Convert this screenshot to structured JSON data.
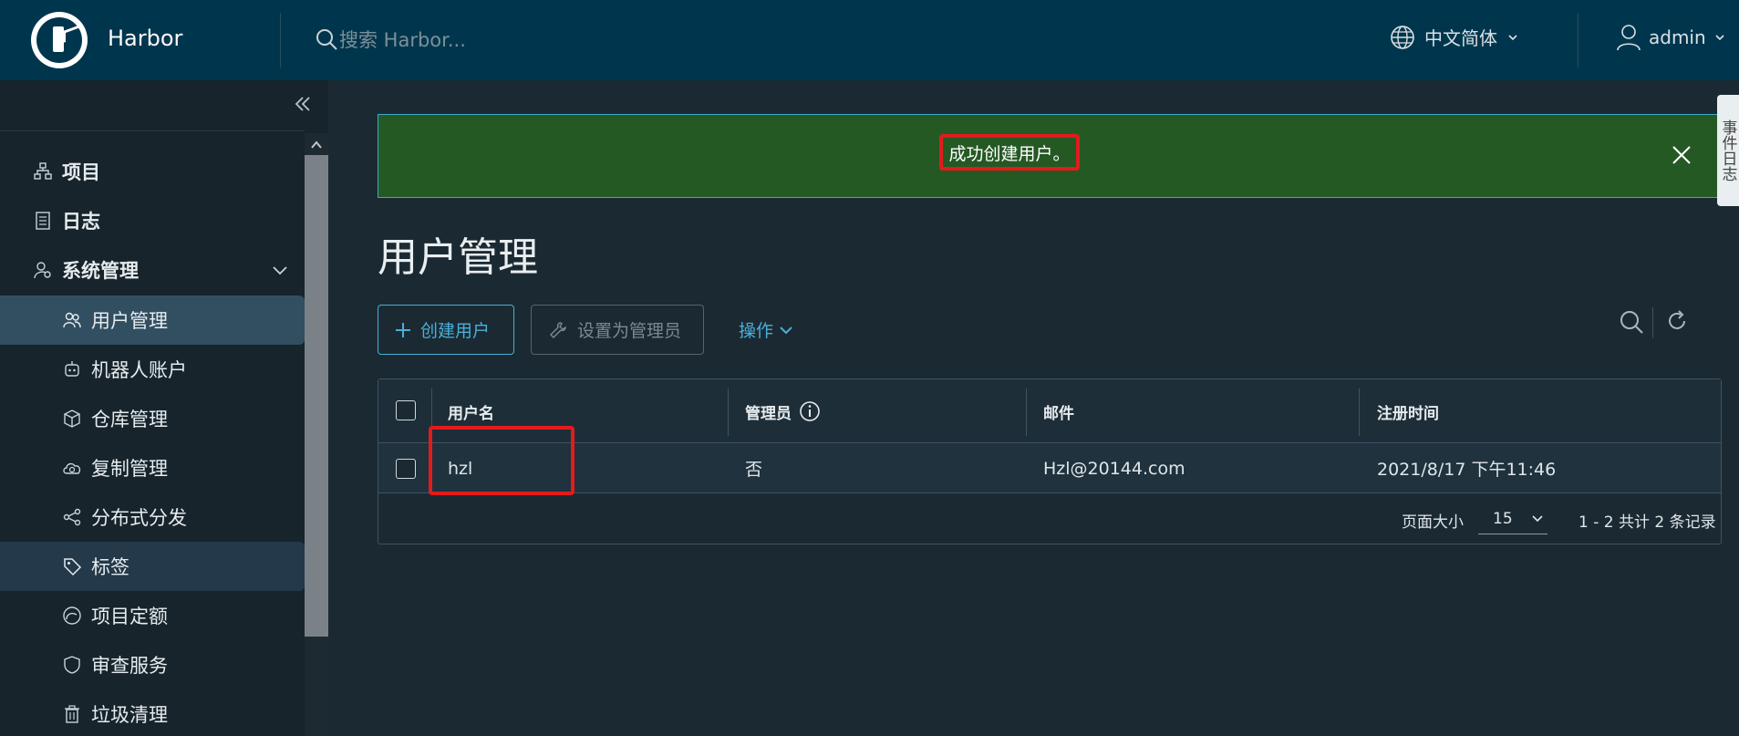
{
  "header": {
    "brand": "Harbor",
    "search_placeholder": "搜索 Harbor...",
    "language": "中文简体",
    "user": "admin"
  },
  "sidebar": {
    "items": [
      {
        "label": "项目",
        "icon": "projects-icon"
      },
      {
        "label": "日志",
        "icon": "logs-icon"
      },
      {
        "label": "系统管理",
        "icon": "admin-settings-icon"
      },
      {
        "label": "用户管理",
        "icon": "users-icon"
      },
      {
        "label": "机器人账户",
        "icon": "robot-icon"
      },
      {
        "label": "仓库管理",
        "icon": "registry-box-icon"
      },
      {
        "label": "复制管理",
        "icon": "cloud-replication-icon"
      },
      {
        "label": "分布式分发",
        "icon": "share-icon"
      },
      {
        "label": "标签",
        "icon": "tag-icon"
      },
      {
        "label": "项目定额",
        "icon": "quota-gauge-icon"
      },
      {
        "label": "审查服务",
        "icon": "shield-icon"
      },
      {
        "label": "垃圾清理",
        "icon": "trash-icon"
      }
    ]
  },
  "alert": {
    "message": "成功创建用户。",
    "side_tab": "事件日志"
  },
  "page": {
    "title": "用户管理"
  },
  "toolbar": {
    "create_user": "创建用户",
    "set_admin": "设置为管理员",
    "actions": "操作"
  },
  "table": {
    "columns": [
      "用户名",
      "管理员",
      "邮件",
      "注册时间"
    ],
    "rows": [
      {
        "username": "hzl",
        "admin": "否",
        "email": "Hzl@20144.com",
        "registered": "2021/8/17 下午11:46"
      }
    ],
    "footer": {
      "page_size_label": "页面大小",
      "page_size": "15",
      "summary": "1 - 2 共计 2 条记录"
    }
  },
  "colors": {
    "header_bg": "#00364d",
    "accent": "#49afd9",
    "success_bg": "#255924",
    "highlight_red": "#e31b1b"
  }
}
